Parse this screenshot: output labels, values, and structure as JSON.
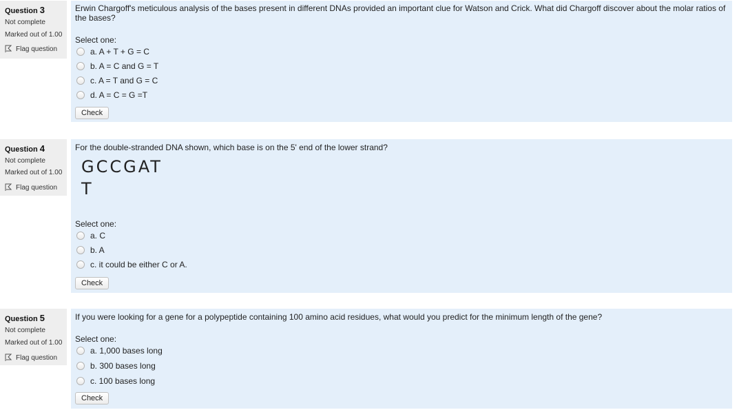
{
  "questions": [
    {
      "label": "Question",
      "number": "3",
      "state": "Not complete",
      "mark": "Marked out of 1.00",
      "flag_label": "Flag question",
      "text": "Erwin Chargoff's meticulous analysis of the bases present in different DNAs provided an important clue for Watson and Crick.  What did Chargoff discover about the molar ratios of the bases?",
      "prompt": "Select one:",
      "options": [
        "a. A + T + G = C",
        "b. A = C and G = T",
        "c. A = T and G = C",
        "d. A = C = G =T"
      ],
      "check_label": "Check"
    },
    {
      "label": "Question",
      "number": "4",
      "state": "Not complete",
      "mark": "Marked out of 1.00",
      "flag_label": "Flag question",
      "text": "For the double-stranded DNA shown, which base is on the 5' end of the lower strand?",
      "dna_top": "GCCGAT",
      "dna_bottom": "T",
      "prompt": "Select one:",
      "options": [
        "a. C",
        "b. A",
        "c. it could be either C or A."
      ],
      "check_label": "Check"
    },
    {
      "label": "Question",
      "number": "5",
      "state": "Not complete",
      "mark": "Marked out of 1.00",
      "flag_label": "Flag question",
      "text": "If you were looking for a gene for a polypeptide containing 100 amino acid residues, what would you predict for the minimum length of the gene?",
      "prompt": "Select one:",
      "options": [
        "a. 1,000 bases long",
        "b. 300 bases long",
        "c. 100 bases long"
      ],
      "check_label": "Check"
    }
  ]
}
